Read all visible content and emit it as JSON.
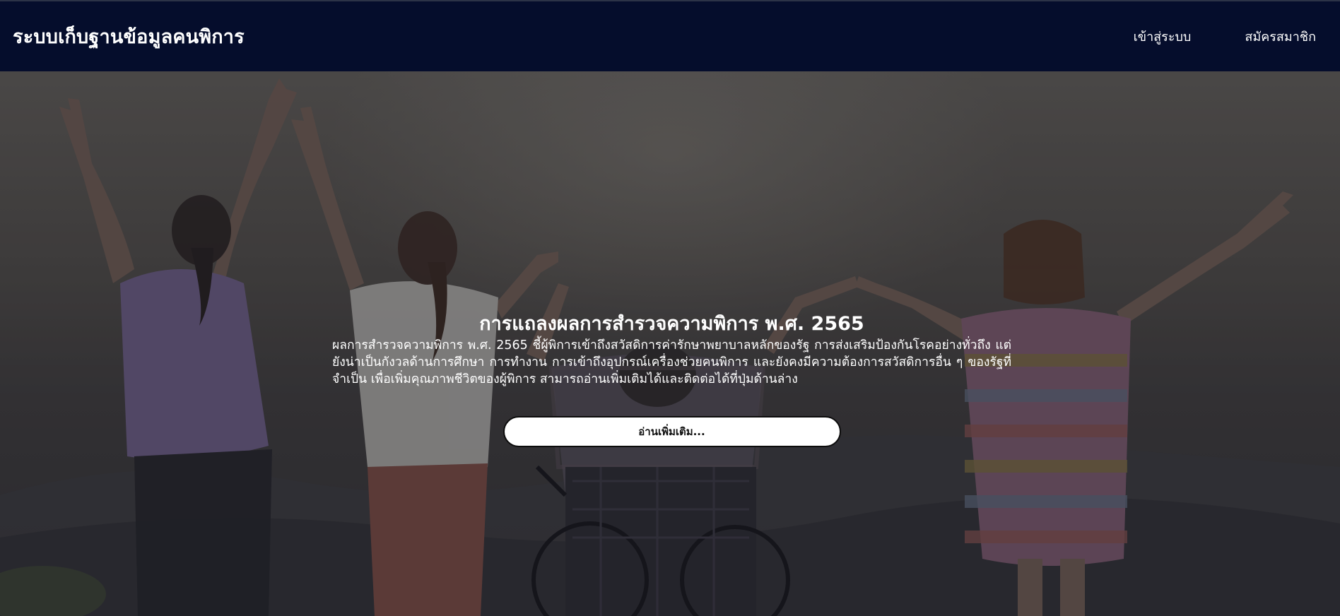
{
  "navbar": {
    "brand": "ระบบเก็บฐานข้อมูลคนพิการ",
    "links": [
      {
        "label": "เข้าสู่ระบบ"
      },
      {
        "label": "สมัครสมาชิก"
      }
    ],
    "background": "#050d2c"
  },
  "hero": {
    "title": "การแถลงผลการสำรวจความพิการ พ.ศ. 2565",
    "description": "ผลการสำรวจความพิการ พ.ศ. 2565 ชี้ผู้พิการเข้าถึงสวัสดิการค่ารักษาพยาบาลหลักของรัฐ การส่งเสริมป้องกันโรคอย่างทั่วถึง แต่ยังน่าเป็นกังวลด้านการศึกษา การทำงาน การเข้าถึงอุปกรณ์เครื่องช่วยคนพิการ และยังคงมีความต้องการสวัสดิการอื่น ๆ ของรัฐที่จำเป็น เพื่อเพิ่มคุณภาพชีวิตของผู้พิการ สามารถอ่านเพิ่มเติมได้และติดต่อได้ที่ปุ่มด้านล่าง",
    "button_label": "อ่านเพิ่มเติม...",
    "background_image": "people-raising-hands-with-wheelchair-photo"
  }
}
